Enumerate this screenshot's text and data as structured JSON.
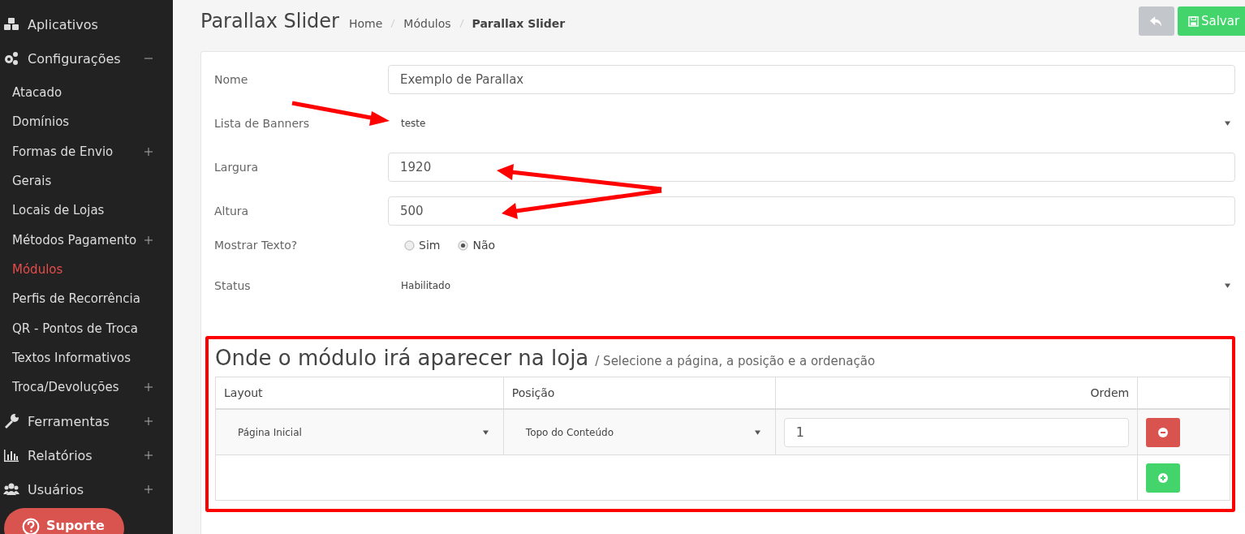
{
  "sidebar": {
    "items": [
      {
        "label": "Aplicativos",
        "kind": "link",
        "selected": false
      },
      {
        "label": "Configurações",
        "kind": "folder",
        "expanded": true,
        "selected": false,
        "children": [
          {
            "label": "Atacado",
            "kind": "link",
            "selected": false
          },
          {
            "label": "Domínios",
            "kind": "link",
            "selected": false
          },
          {
            "label": "Formas de Envio",
            "kind": "folder",
            "expanded": false,
            "selected": false
          },
          {
            "label": "Gerais",
            "kind": "link",
            "selected": false
          },
          {
            "label": "Locais de Lojas",
            "kind": "link",
            "selected": false
          },
          {
            "label": "Métodos Pagamento",
            "kind": "folder",
            "expanded": false,
            "selected": false
          },
          {
            "label": "Módulos",
            "kind": "link",
            "selected": true
          },
          {
            "label": "Perfis de Recorrência",
            "kind": "link",
            "selected": false
          },
          {
            "label": "QR - Pontos de Troca",
            "kind": "link",
            "selected": false
          },
          {
            "label": "Textos Informativos",
            "kind": "link",
            "selected": false
          },
          {
            "label": "Troca/Devoluções",
            "kind": "folder",
            "expanded": false,
            "selected": false
          }
        ]
      },
      {
        "label": "Ferramentas",
        "kind": "folder",
        "expanded": false,
        "selected": false
      },
      {
        "label": "Relatórios",
        "kind": "folder",
        "expanded": false,
        "selected": false
      },
      {
        "label": "Usuários",
        "kind": "folder",
        "expanded": false,
        "selected": false
      }
    ]
  },
  "support_button": {
    "label": "Suporte"
  },
  "page": {
    "title": "Parallax Slider",
    "breadcrumb": [
      {
        "label": "Home",
        "current": false
      },
      {
        "label": "Módulos",
        "current": false
      },
      {
        "label": "Parallax Slider",
        "current": true
      }
    ]
  },
  "buttons": [
    {
      "kind": "back"
    },
    {
      "kind": "save",
      "label": "Salvar"
    }
  ],
  "form": {
    "fields": [
      {
        "label": "Nome",
        "kind": "input",
        "value": "Exemplo de Parallax"
      },
      {
        "label": "Lista de Banners",
        "kind": "select",
        "value": "teste"
      },
      {
        "label": "Largura",
        "kind": "input",
        "value": "1920"
      },
      {
        "label": "Altura",
        "kind": "input",
        "value": "500"
      },
      {
        "label": "Mostrar Texto?",
        "kind": "radio",
        "options": [
          {
            "label": "Sim",
            "selected": false
          },
          {
            "label": "Não",
            "selected": true
          }
        ]
      },
      {
        "label": "Status",
        "kind": "select",
        "value": "Habilitado"
      }
    ]
  },
  "placement": {
    "title": "Onde o módulo irá aparecer na loja",
    "subtitle": "/ Selecione a página, a posição e a ordenação",
    "columns": [
      "Layout",
      "Posição",
      "Ordem"
    ],
    "rows": [
      {
        "layout": "Página Inicial",
        "position": "Topo do Conteúdo",
        "order": "1"
      }
    ]
  }
}
